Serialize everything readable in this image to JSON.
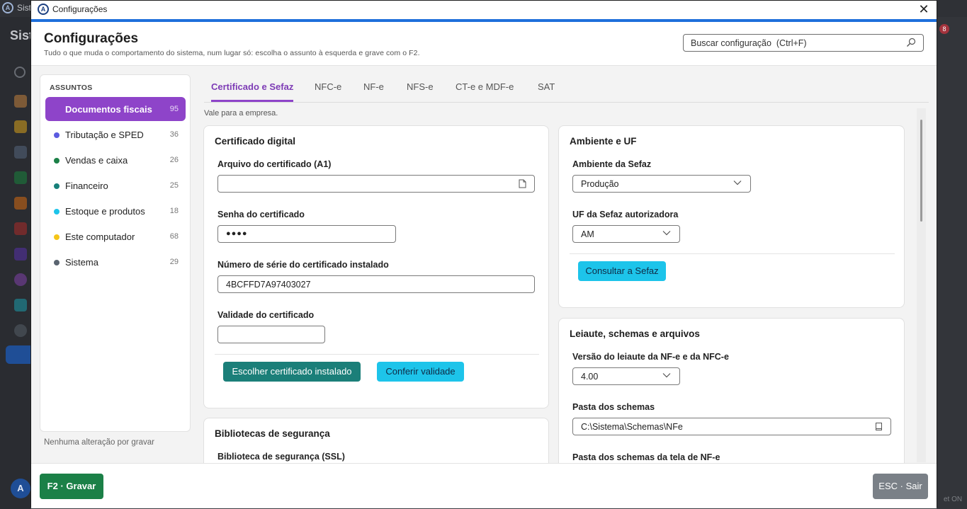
{
  "background": {
    "title": "Sist",
    "heading": "Sist",
    "avatar": "A",
    "badge": "8",
    "footer_text": "et ON"
  },
  "window": {
    "title": "Configurações",
    "close_label": "✕"
  },
  "header": {
    "title": "Configurações",
    "subtitle": "Tudo o que muda o comportamento do sistema, num lugar só: escolha o assunto à esquerda e grave com o F2.",
    "search_placeholder": "Buscar configuração  (Ctrl+F)"
  },
  "subjects": {
    "title": "ASSUNTOS",
    "items": [
      {
        "label": "Documentos fiscais",
        "count": "95",
        "color": "#8e44c9",
        "active": true
      },
      {
        "label": "Tributação e SPED",
        "count": "36",
        "color": "#5b5be0"
      },
      {
        "label": "Vendas e caixa",
        "count": "26",
        "color": "#1b8047"
      },
      {
        "label": "Financeiro",
        "count": "25",
        "color": "#17807a"
      },
      {
        "label": "Estoque e produtos",
        "count": "18",
        "color": "#1dc4ea"
      },
      {
        "label": "Este computador",
        "count": "68",
        "color": "#f5c518"
      },
      {
        "label": "Sistema",
        "count": "29",
        "color": "#5a6470"
      }
    ],
    "status": "Nenhuma alteração por gravar"
  },
  "tabs": [
    {
      "label": "Certificado e Sefaz",
      "active": true
    },
    {
      "label": "NFC-e"
    },
    {
      "label": "NF-e"
    },
    {
      "label": "NFS-e"
    },
    {
      "label": "CT-e e MDF-e"
    },
    {
      "label": "SAT"
    }
  ],
  "scope": "Vale para a empresa.",
  "cert": {
    "title": "Certificado digital",
    "file_label": "Arquivo do certificado (A1)",
    "file_value": "",
    "password_label": "Senha do certificado",
    "password_value": "●●●●",
    "serial_label": "Número de série do certificado instalado",
    "serial_value": "4BCFFD7A97403027",
    "validity_label": "Validade do certificado",
    "validity_value": "",
    "choose_button": "Escolher certificado instalado",
    "check_button": "Conferir validade"
  },
  "security": {
    "title": "Bibliotecas de segurança",
    "ssl_label": "Biblioteca de segurança (SSL)"
  },
  "env": {
    "title": "Ambiente e UF",
    "env_label": "Ambiente da Sefaz",
    "env_value": "Produção",
    "uf_label": "UF da Sefaz autorizadora",
    "uf_value": "AM",
    "consult_button": "Consultar a Sefaz"
  },
  "layout": {
    "title": "Leiaute, schemas e arquivos",
    "version_label": "Versão do leiaute da NF-e e da NFC-e",
    "version_value": "4.00",
    "schemas_label": "Pasta dos schemas",
    "schemas_value": "C:\\Sistema\\Schemas\\NFe",
    "schemas_nfe_label": "Pasta dos schemas da tela de NF-e"
  },
  "footer": {
    "save_button": "F2 · Gravar",
    "exit_button": "ESC · Sair"
  }
}
